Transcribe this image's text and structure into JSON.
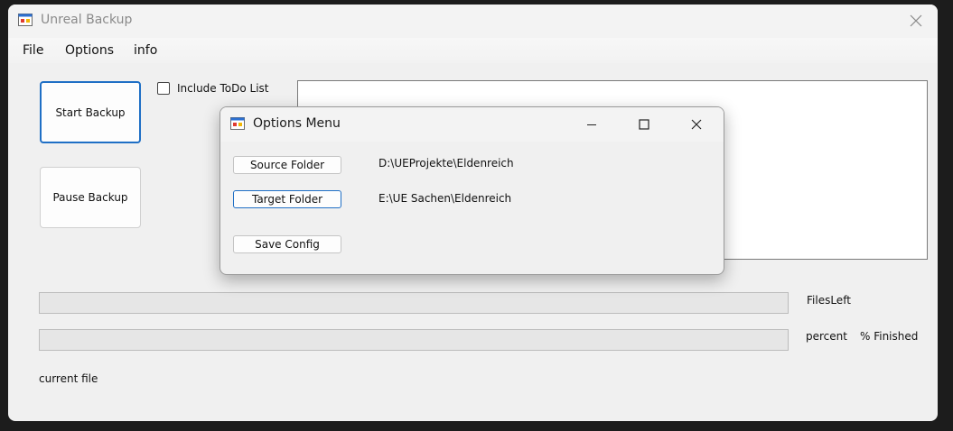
{
  "main_window": {
    "title": "Unreal Backup",
    "icon": "app-window-icon",
    "menu": {
      "file": "File",
      "options": "Options",
      "info": "info"
    },
    "buttons": {
      "start_backup": "Start Backup",
      "pause_backup": "Pause Backup"
    },
    "include_todo": {
      "label": "Include ToDo List",
      "checked": false
    },
    "log_text": "",
    "progress": {
      "files_fraction": 0,
      "percent_fraction": 0
    },
    "labels": {
      "files_left": "FilesLeft",
      "percent": "percent",
      "finished": "% Finished",
      "current_file": "current file"
    }
  },
  "options_dialog": {
    "title": "Options Menu",
    "icon": "app-window-icon",
    "buttons": {
      "source_folder": "Source Folder",
      "target_folder": "Target Folder",
      "save_config": "Save Config"
    },
    "paths": {
      "source": "D:\\UEProjekte\\Eldenreich",
      "target": "E:\\UE Sachen\\Eldenreich"
    }
  },
  "colors": {
    "accent": "#1f6fc5",
    "window_bg": "#f0f0f0",
    "progress_fill": "#06b025"
  }
}
